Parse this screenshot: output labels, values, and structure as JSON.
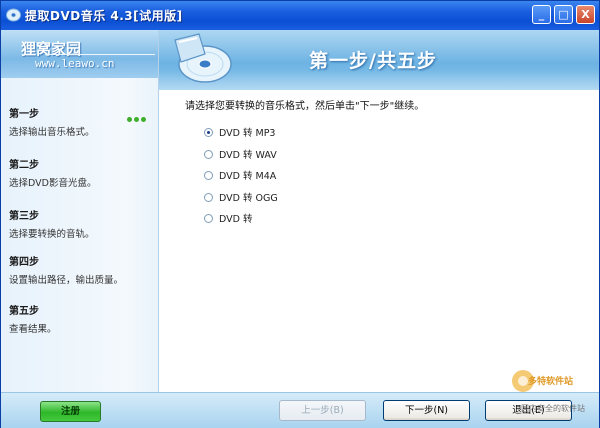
{
  "window": {
    "title": "提取DVD音乐 4.3[试用版]",
    "controls": {
      "minimize": "_",
      "maximize": "□",
      "close": "X"
    }
  },
  "logo": {
    "name": "狸窝家园",
    "url": "www.leawo.cn"
  },
  "steps": [
    {
      "title": "第一步",
      "desc": "选择输出音乐格式。",
      "active": true
    },
    {
      "title": "第二步",
      "desc": "选择DVD影音光盘。"
    },
    {
      "title": "第三步",
      "desc": "选择要转换的音轨。"
    },
    {
      "title": "第四步",
      "desc": "设置输出路径，输出质量。"
    },
    {
      "title": "第五步",
      "desc": "查看结果。"
    }
  ],
  "banner": {
    "title": "第一步/共五步",
    "icon": "disc-icon"
  },
  "main": {
    "instruction": "请选择您要转换的音乐格式，然后单击\"下一步\"继续。",
    "options": [
      {
        "label": "DVD 转 MP3",
        "selected": true
      },
      {
        "label": "DVD 转 WAV",
        "selected": false
      },
      {
        "label": "DVD 转 M4A",
        "selected": false
      },
      {
        "label": "DVD 转 OGG",
        "selected": false
      },
      {
        "label": "DVD 转",
        "selected": false
      }
    ]
  },
  "footer": {
    "register": "注册",
    "prev": "上一步(B)",
    "next": "下一步(N)",
    "exit": "退出(E)"
  },
  "watermark": {
    "text": "多特软件站",
    "sub": "国内安全的软件站"
  },
  "colors": {
    "titlebar": "#0b4fd4",
    "banner": "#6db3e3",
    "register": "#2fb82a",
    "active_dots": "#3fae2a"
  }
}
